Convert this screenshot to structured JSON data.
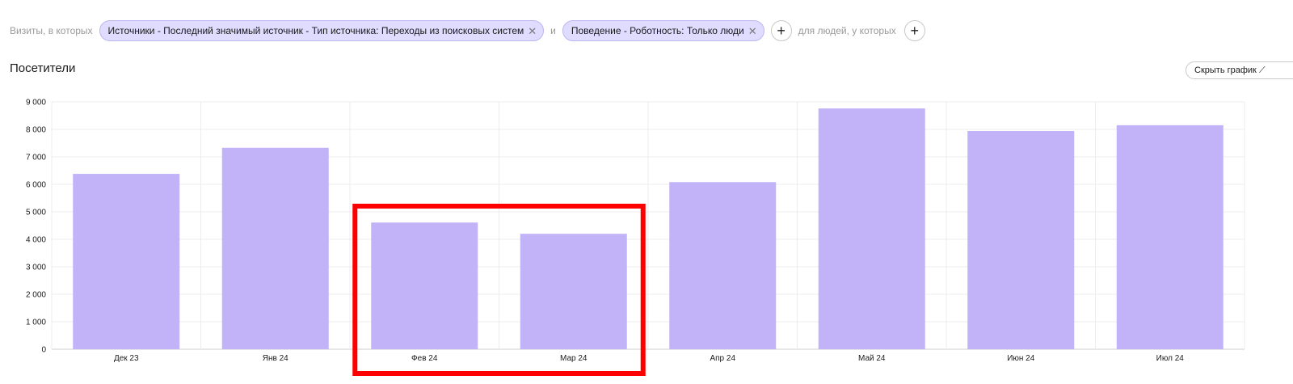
{
  "filters": {
    "prefix": "Визиты, в которых",
    "chips": [
      {
        "label": "Источники - Последний значимый источник - Тип источника: Переходы из поисковых систем"
      },
      {
        "label": "Поведение - Роботность: Только люди"
      }
    ],
    "and_label": "и",
    "people_label": "для людей, у которых",
    "remove_glyph": "✕",
    "add_glyph": "+"
  },
  "header": {
    "title": "Посетители",
    "hide_chart_label": "Скрыть график ⟋"
  },
  "chart_data": {
    "type": "bar",
    "categories": [
      "Дек 23",
      "Янв 24",
      "Фев 24",
      "Мар 24",
      "Апр 24",
      "Май 24",
      "Июн 24",
      "Июл 24"
    ],
    "values": [
      6380,
      7330,
      4610,
      4200,
      6080,
      8760,
      7940,
      8150
    ],
    "yticks": [
      "0",
      "1 000",
      "2 000",
      "3 000",
      "4 000",
      "5 000",
      "6 000",
      "7 000",
      "8 000",
      "9 000"
    ],
    "ylim": [
      0,
      9000
    ],
    "highlight": {
      "from": "Фев 24",
      "to": "Мар 24",
      "color": "#ff0000"
    },
    "bar_color": "#c2b2f8",
    "grid": true
  }
}
